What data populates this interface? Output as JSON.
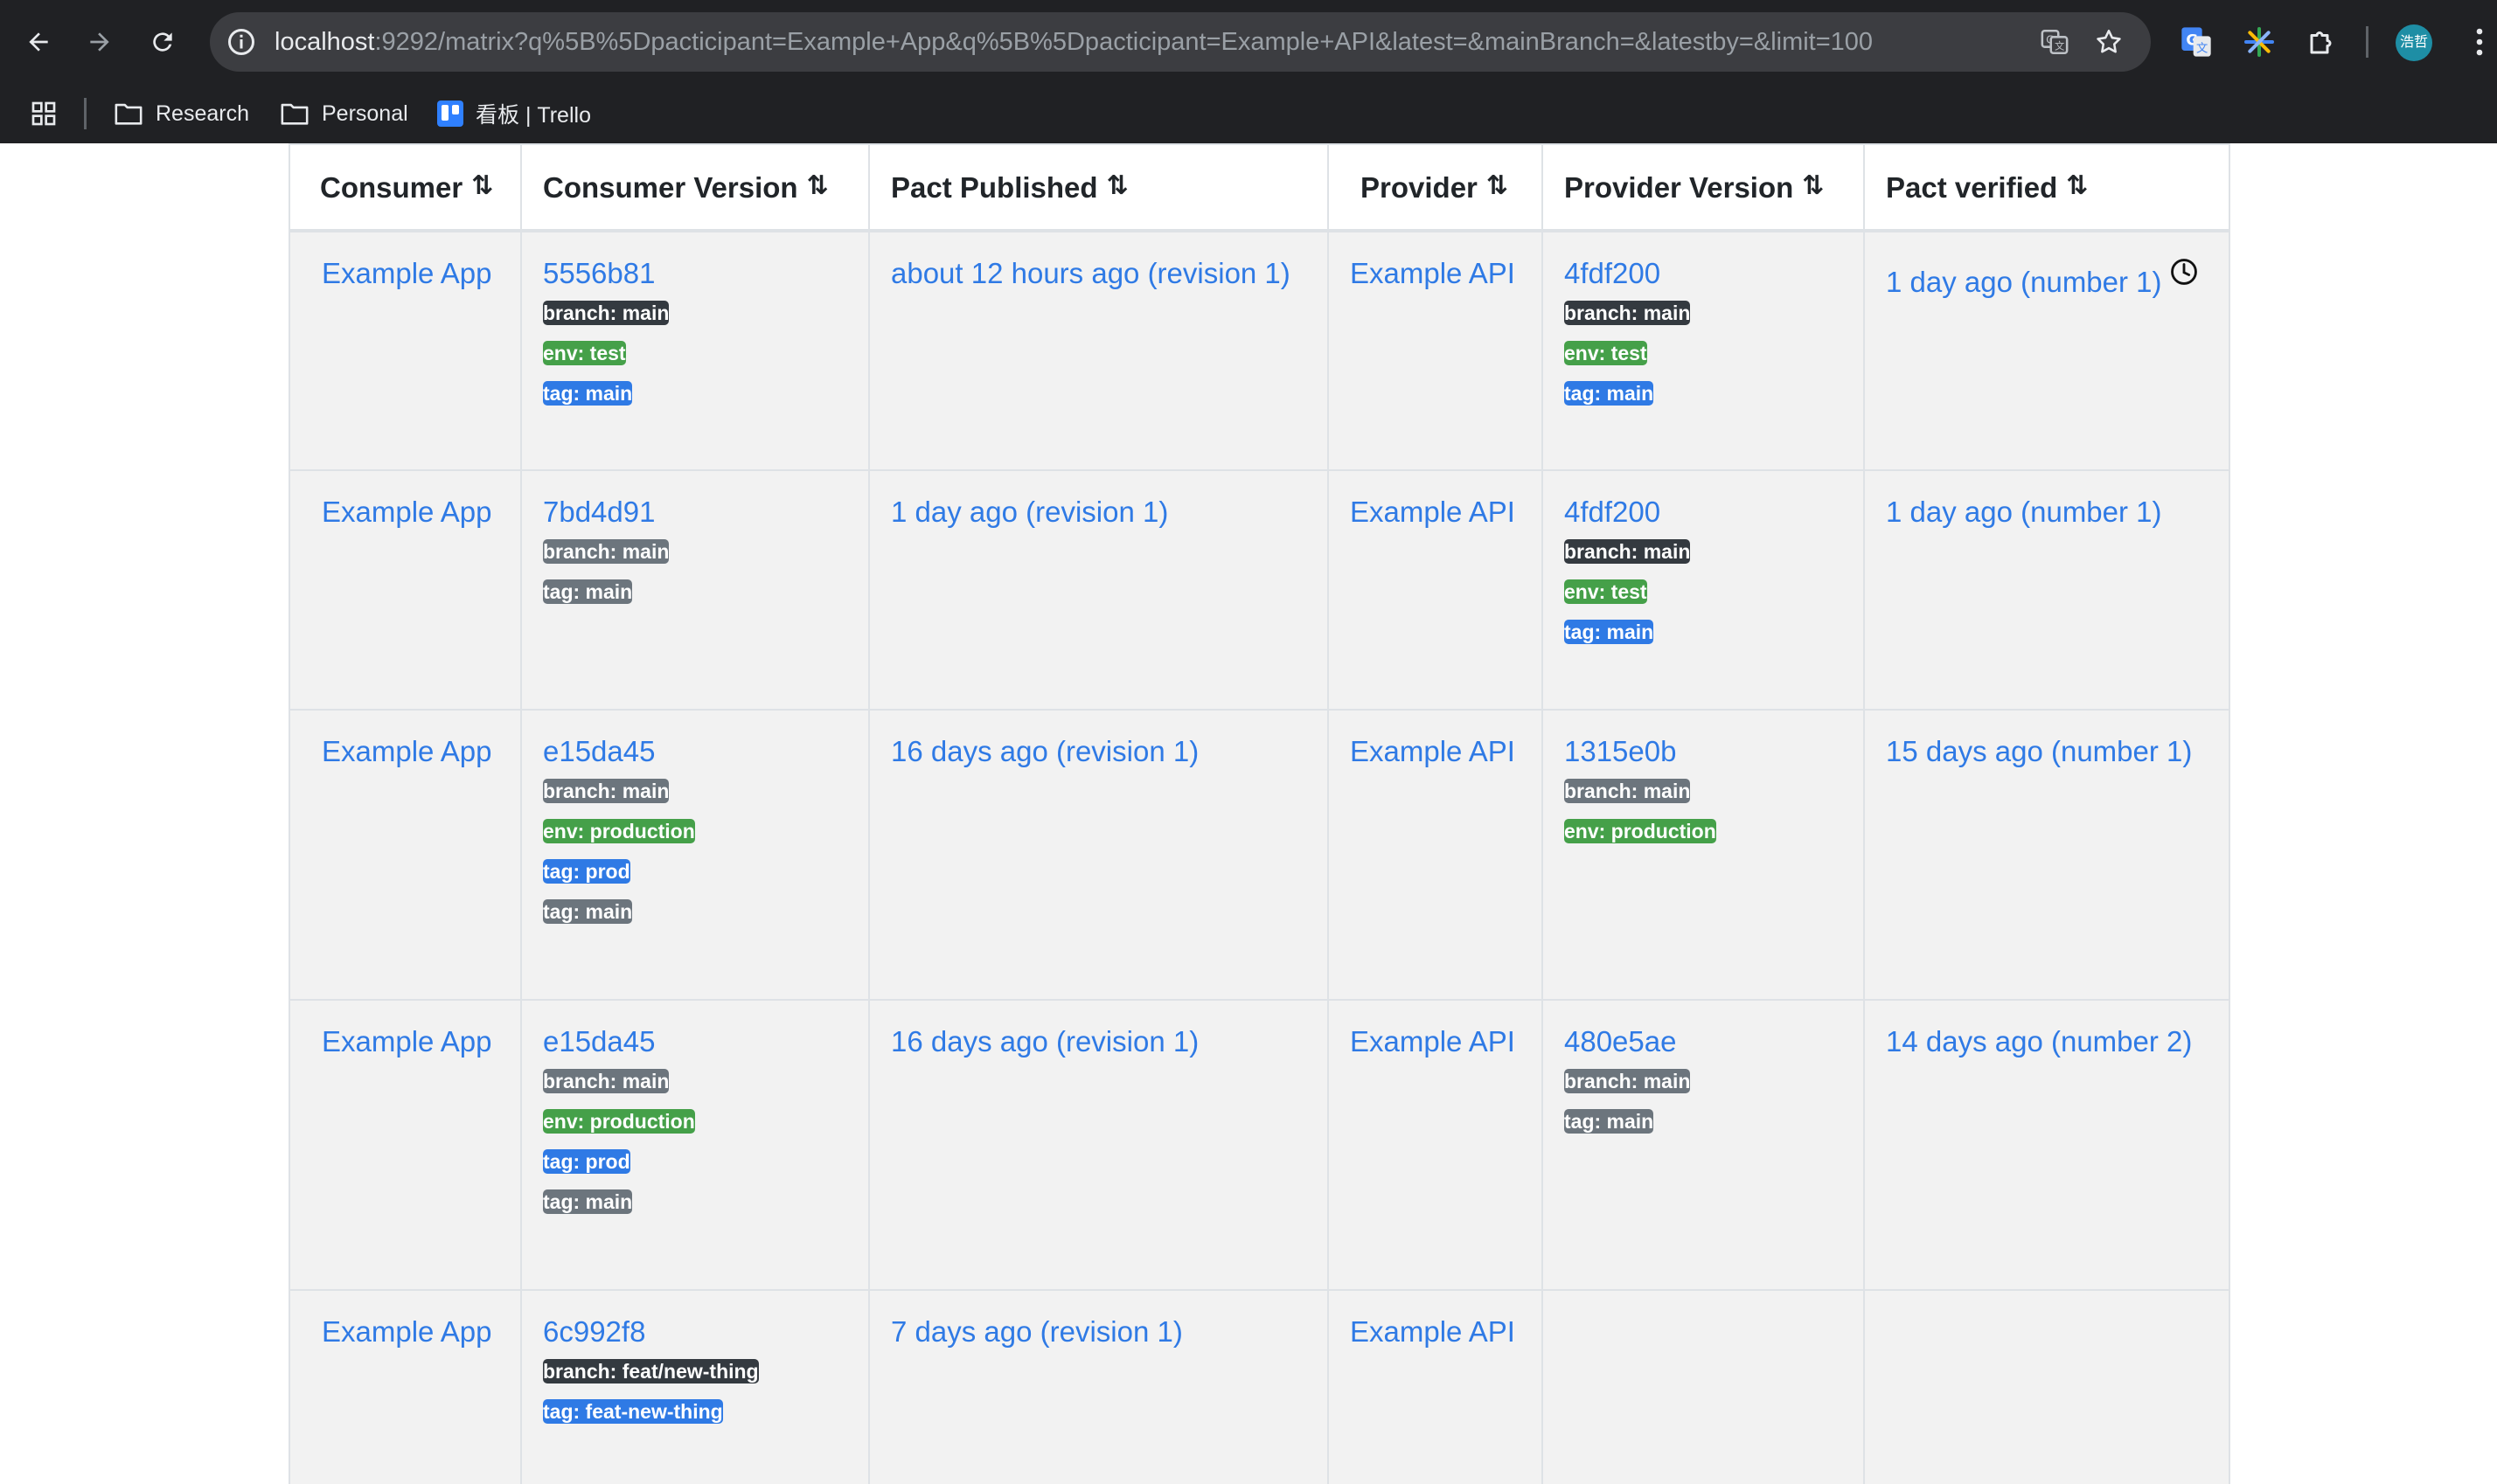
{
  "browser": {
    "url_host": "localhost",
    "url_rest": ":9292/matrix?q%5B%5Dpacticipant=Example+App&q%5B%5Dpacticipant=Example+API&latest=&mainBranch=&latestby=&limit=100",
    "avatar_text": "浩哲",
    "bookmarks": [
      {
        "label": "Research"
      },
      {
        "label": "Personal"
      },
      {
        "label": "看板 | Trello"
      }
    ]
  },
  "table": {
    "headers": {
      "consumer": "Consumer",
      "consumer_version": "Consumer Version",
      "pact_published": "Pact Published",
      "provider": "Provider",
      "provider_version": "Provider Version",
      "pact_verified": "Pact verified"
    },
    "rows": [
      {
        "consumer": "Example App",
        "consumer_version": "5556b81",
        "consumer_badges": [
          "branch: main",
          "env: test",
          "tag: main"
        ],
        "pact_published": "about 12 hours ago (revision 1)",
        "provider": "Example API",
        "provider_version": "4fdf200",
        "provider_badges": [
          "branch: main",
          "env: test",
          "tag: main"
        ],
        "pact_verified": "1 day ago (number 1)",
        "verification_status": "success"
      },
      {
        "consumer": "Example App",
        "consumer_version": "7bd4d91",
        "consumer_badges": [
          "branch: main",
          "tag: main"
        ],
        "pact_published": "1 day ago (revision 1)",
        "provider": "Example API",
        "provider_version": "4fdf200",
        "provider_badges": [
          "branch: main",
          "env: test",
          "tag: main"
        ],
        "pact_verified": "1 day ago (number 1)",
        "verification_status": "success"
      },
      {
        "consumer": "Example App",
        "consumer_version": "e15da45",
        "consumer_badges": [
          "branch: main",
          "env: production",
          "tag: prod",
          "tag: main"
        ],
        "pact_published": "16 days ago (revision 1)",
        "provider": "Example API",
        "provider_version": "1315e0b",
        "provider_badges": [
          "branch: main",
          "env: production"
        ],
        "pact_verified": "15 days ago (number 1)",
        "verification_status": "success"
      },
      {
        "consumer": "Example App",
        "consumer_version": "e15da45",
        "consumer_badges": [
          "branch: main",
          "env: production",
          "tag: prod",
          "tag: main"
        ],
        "pact_published": "16 days ago (revision 1)",
        "provider": "Example API",
        "provider_version": "480e5ae",
        "provider_badges": [
          "branch: main",
          "tag: main"
        ],
        "pact_verified": "14 days ago (number 2)",
        "verification_status": "failed"
      },
      {
        "consumer": "Example App",
        "consumer_version": "6c992f8",
        "consumer_badges": [
          "branch: feat/new-thing",
          "tag: feat-new-thing"
        ],
        "pact_published": "7 days ago (revision 1)",
        "provider": "Example API",
        "provider_version": "",
        "provider_badges": [],
        "pact_verified": "",
        "verification_status": "none"
      }
    ]
  },
  "colors": {
    "link": "#2f7ae5",
    "verified_success": "#c8e6c9",
    "verified_failed": "#efc8cd",
    "badge_branch_dark": "#343a40",
    "badge_grey": "#6c757d",
    "badge_env": "#45a049",
    "badge_tag": "#2f7ae5"
  }
}
